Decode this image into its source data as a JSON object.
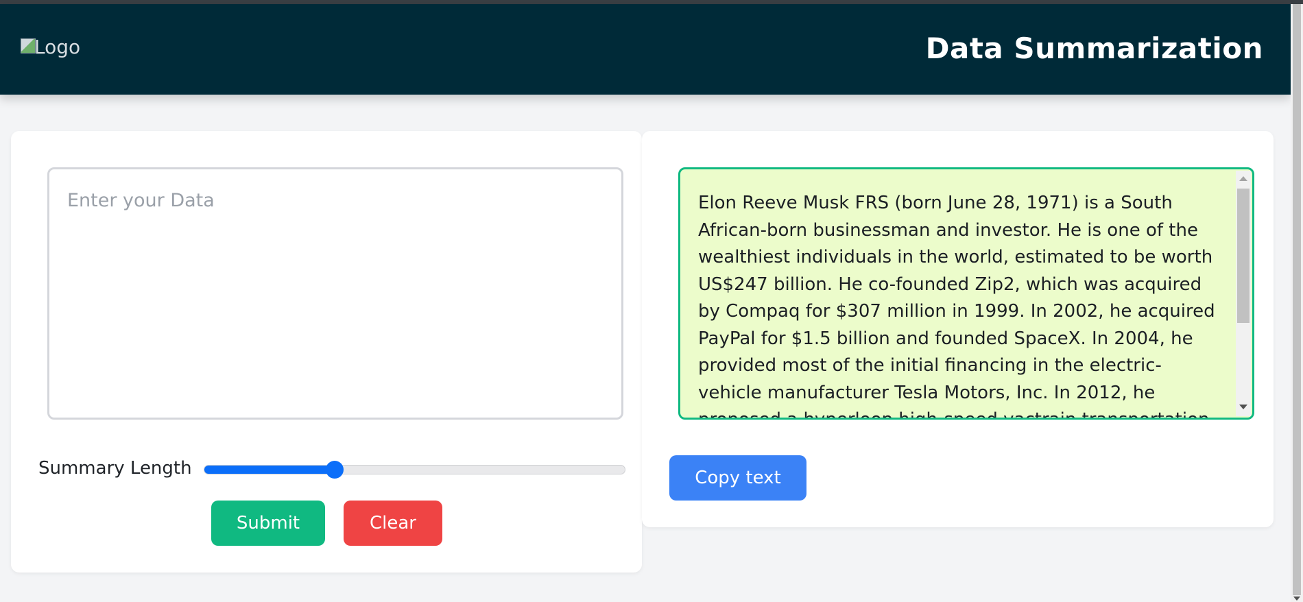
{
  "header": {
    "logo_alt": "Logo",
    "title": "Data Summarization"
  },
  "input": {
    "placeholder": "Enter your Data",
    "value": ""
  },
  "slider": {
    "label": "Summary Length",
    "value_fraction": 0.31
  },
  "buttons": {
    "submit_label": "Submit",
    "clear_label": "Clear",
    "copy_label": "Copy text"
  },
  "output": {
    "text": "Elon Reeve Musk FRS (born June 28, 1971) is a South African-born businessman and investor. He is one of the wealthiest individuals in the world, estimated to be worth US$247 billion. He co-founded Zip2, which was acquired by Compaq for $307 million in 1999. In 2002, he acquired PayPal for $1.5 billion and founded SpaceX. In 2004, he provided most of the initial financing in the electric-vehicle manufacturer Tesla Motors, Inc. In 2012, he proposed a hyperloop high-speed vactrain transportation system. In"
  },
  "colors": {
    "header_bg": "#002a38",
    "submit": "#10b981",
    "clear": "#ef4444",
    "copy": "#3b82f6",
    "slider_accent": "#0b6ef9",
    "output_bg": "#ecfccb",
    "output_border": "#10b981"
  },
  "icons": {
    "logo": "broken-image-icon"
  }
}
